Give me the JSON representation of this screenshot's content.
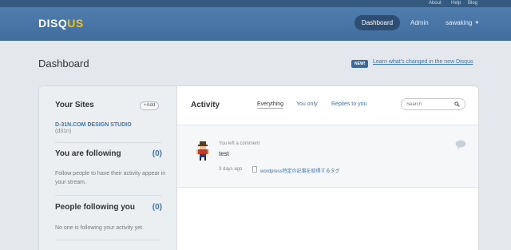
{
  "util": {
    "about": "About",
    "help": "Help",
    "blog": "Blog"
  },
  "header": {
    "logo_main": "DISQ",
    "logo_accent": "US",
    "nav": {
      "dashboard": "Dashboard",
      "admin": "Admin",
      "user": "sawaking"
    },
    "colors": {
      "bar": "#4a78a8",
      "accent": "#f0c419",
      "active_pill": "#2d4e72"
    }
  },
  "page": {
    "title": "Dashboard",
    "new_badge": "NEW!",
    "changes_link": "Learn what's changed in the new Disqus"
  },
  "sidebar": {
    "your_sites": {
      "heading": "Your Sites",
      "add_label": "+Add",
      "site_name": "D-31N.COM DESIGN STUDIO",
      "site_short": "(d31n)"
    },
    "following": {
      "heading": "You are following",
      "count": "(0)",
      "text": "Follow people to have their activity appear in your stream."
    },
    "followers": {
      "heading": "People following you",
      "count": "(0)",
      "text": "No one is following your activity yet."
    }
  },
  "activity": {
    "title": "Activity",
    "filters": [
      "Everything",
      "You only",
      "Replies to you"
    ],
    "search_placeholder": "Search",
    "items": [
      {
        "meta": "You left a comment",
        "text": "test",
        "time": "3 days ago",
        "thread": "wordpress特定の記事を取得するタグ",
        "avatar": "pixel-character-avatar"
      }
    ]
  },
  "icons": {
    "search": "magnifier-icon",
    "comment": "speech-bubble-icon",
    "document": "document-icon",
    "caret": "caret-down-icon"
  }
}
